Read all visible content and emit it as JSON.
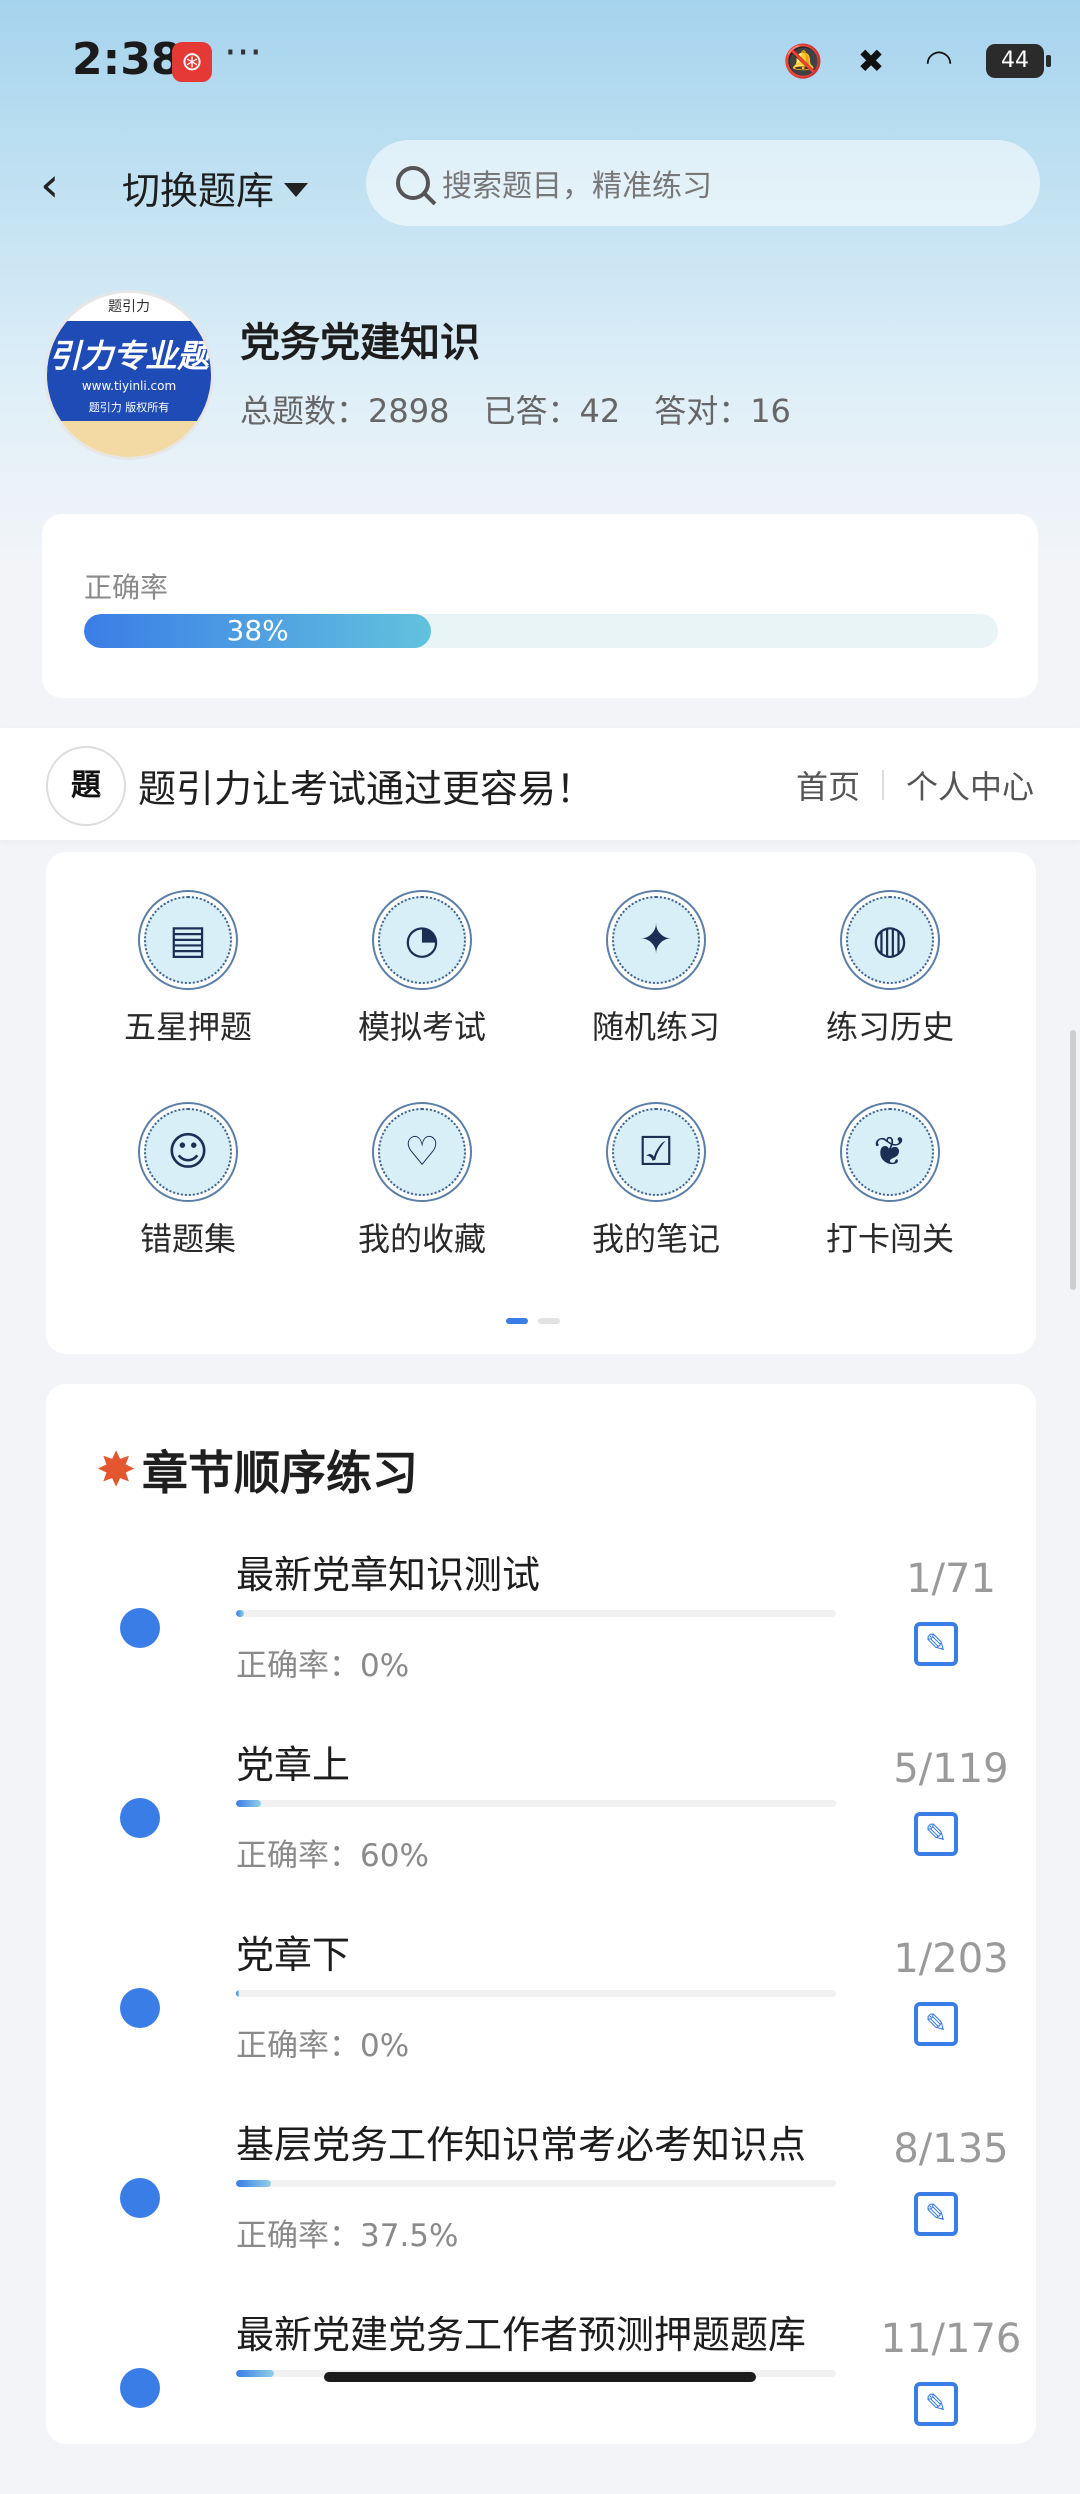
{
  "status_bar": {
    "time": "2:38",
    "app_icon_glyph": "⊛",
    "dots": "···",
    "battery": "44"
  },
  "header": {
    "back_glyph": "‹",
    "switch_bank_label": "切换题库",
    "search_placeholder": "搜索题目，精准练习"
  },
  "bank": {
    "logo_top": "题引力",
    "logo_text": "引力专业题",
    "logo_url": "www.tiyinli.com",
    "logo_sub": "题引力 版权所有",
    "title": "党务党建知识",
    "total": "总题数：2898",
    "answered": "已答：42",
    "correct": "答对：16"
  },
  "accuracy": {
    "label": "正确率",
    "percent": 38,
    "percent_text": "38%"
  },
  "banner": {
    "logo_glyph": "題",
    "text": "题引力让考试通过更容易！",
    "link_home": "首页",
    "link_personal": "个人中心"
  },
  "grid": {
    "items": [
      {
        "label": "五星押题",
        "icon": "id-card-icon",
        "glyph": "▤"
      },
      {
        "label": "模拟考试",
        "icon": "speedometer-icon",
        "glyph": "◔"
      },
      {
        "label": "随机练习",
        "icon": "network-icon",
        "glyph": "✦"
      },
      {
        "label": "练习历史",
        "icon": "globe-icon",
        "glyph": "◍"
      },
      {
        "label": "错题集",
        "icon": "head-icon",
        "glyph": "☺"
      },
      {
        "label": "我的收藏",
        "icon": "heart-icon",
        "glyph": "♡"
      },
      {
        "label": "我的笔记",
        "icon": "note-check-icon",
        "glyph": "☑"
      },
      {
        "label": "打卡闯关",
        "icon": "sprout-icon",
        "glyph": "❦"
      }
    ],
    "page_index": 1,
    "page_count": 2
  },
  "chapters": {
    "title": "章节顺序练习",
    "fire_glyph": "✸",
    "items": [
      {
        "title": "最新党章知识测试",
        "progress": 0.014,
        "accuracy": "正确率：0%",
        "count": "1/71"
      },
      {
        "title": "党章上",
        "progress": 0.042,
        "accuracy": "正确率：60%",
        "count": "5/119"
      },
      {
        "title": "党章下",
        "progress": 0.005,
        "accuracy": "正确率：0%",
        "count": "1/203"
      },
      {
        "title": "基层党务工作知识常考必考知识点",
        "progress": 0.059,
        "accuracy": "正确率：37.5%",
        "count": "8/135"
      },
      {
        "title": "最新党建党务工作者预测押题题库",
        "progress": 0.0625,
        "accuracy": "",
        "count": "11/176"
      }
    ],
    "edit_glyph": "✎"
  },
  "colors": {
    "accent": "#3b7de6",
    "teal": "#62c2dd"
  }
}
